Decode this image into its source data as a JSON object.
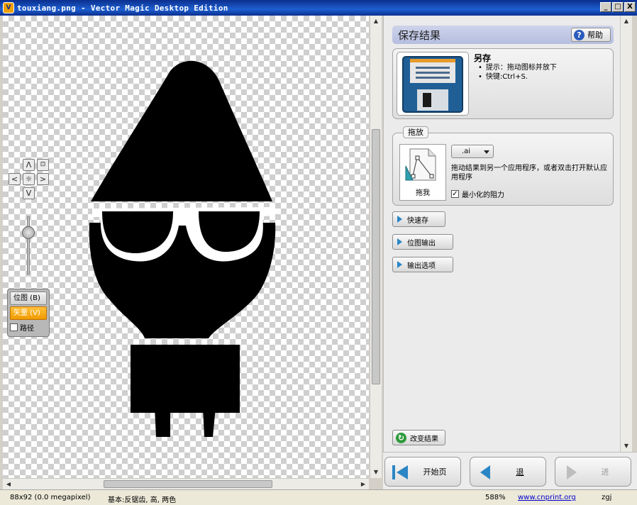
{
  "window": {
    "title": "touxiang.png - Vector Magic Desktop Edition",
    "controls": {
      "minimize": "_",
      "maximize": "□",
      "close": "X"
    }
  },
  "canvas": {
    "nav": {
      "up": "Λ",
      "down": "V",
      "left": "<",
      "right": ">",
      "center": "☼",
      "fit": "⊡"
    },
    "zoom_level": 0.22,
    "modes": {
      "bitmap": "位图 (B)",
      "vector": "矢量 (V)",
      "path": "路径",
      "path_checked": false,
      "active": "vector"
    }
  },
  "panel": {
    "header": {
      "title": "保存结果",
      "help_label": "帮助"
    },
    "save_as": {
      "title": "另存",
      "tips": [
        "提示：拖动图标并放下",
        "快键:Ctrl+S."
      ]
    },
    "drag_drop": {
      "legend": "拖放",
      "tile_label": "拖我",
      "format": ".ai",
      "description": "拖动结果到另一个应用程序，或者双击打开默认应用程序",
      "minimize_resistance_label": "最小化的阻力",
      "minimize_resistance_checked": true
    },
    "actions": {
      "quick_save": "快速存",
      "bitmap_output": "位图输出",
      "output_options": "输出选项"
    },
    "change_result": "改变结果"
  },
  "navigation": {
    "home": "开始页",
    "back": "退",
    "forward": "进"
  },
  "status": {
    "image_info": "88x92 (0.0 megapixel)",
    "basic_info": "基本:反锯齿, 高, 两色",
    "zoom": "588%",
    "site": "www.cnprint.org",
    "user": "zgj"
  },
  "colors": {
    "title_bar": "#0b2f8f",
    "panel_header": "#b6bee0",
    "active_mode": "#f09a00",
    "action_triangle": "#2b86c5",
    "help_icon": "#2a5bbd",
    "refresh_icon": "#2e9a3c"
  },
  "icons": {
    "app": "vector-magic-icon",
    "save_as": "floppy-disk-icon",
    "drag": "vector-drawing-icon",
    "help": "question-icon",
    "change": "refresh-icon"
  }
}
